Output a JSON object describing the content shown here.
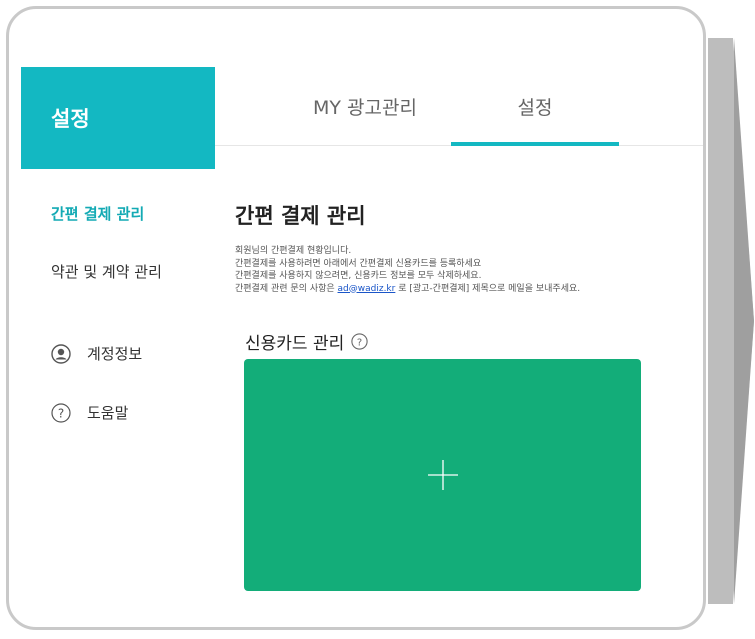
{
  "sidebar": {
    "title": "설정",
    "items": [
      {
        "label": "간편 결제 관리",
        "active": true
      },
      {
        "label": "약관 및 계약 관리",
        "active": false
      },
      {
        "label": "계정정보",
        "icon": "user-circle-icon"
      },
      {
        "label": "도움말",
        "icon": "question-circle-icon"
      }
    ]
  },
  "tabs": [
    {
      "label": "MY 광고관리",
      "active": false
    },
    {
      "label": "설정",
      "active": true
    }
  ],
  "main": {
    "title": "간편 결제 관리",
    "description": {
      "line1": "회원님의 간편결제 현황입니다.",
      "line2": "간편결제를 사용하려면 아래에서 간편결제 신용카드를 등록하세요",
      "line3": "간편결제를 사용하지 않으려면, 신용카드 정보를 모두 삭제하세요.",
      "line4_prefix": "간편결제 관련 문의 사항은 ",
      "email": "ad@wadiz.kr",
      "line4_suffix": " 로 [광고-간편결제] 제목으로 메일을 보내주세요."
    },
    "card_section_title": "신용카드 관리",
    "add_card_icon": "plus-icon"
  },
  "colors": {
    "accent": "#13b8c2",
    "card": "#13ad79",
    "link": "#1a55c8"
  }
}
